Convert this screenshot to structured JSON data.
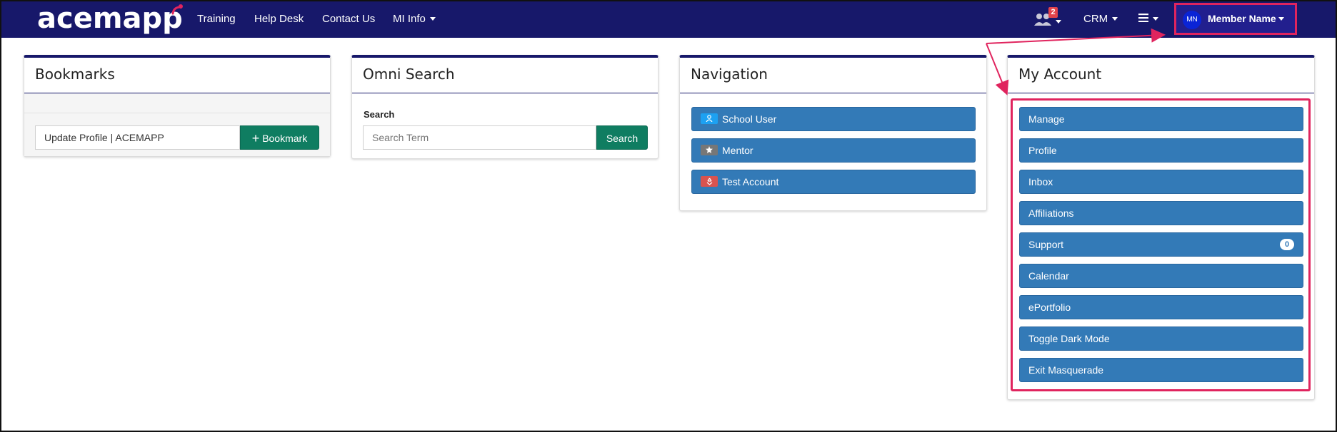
{
  "navbar": {
    "logo_text": "acemapp",
    "links": [
      {
        "label": "Training"
      },
      {
        "label": "Help Desk"
      },
      {
        "label": "Contact Us"
      },
      {
        "label": "MI Info"
      }
    ],
    "notification_count": "2",
    "crm_label": "CRM",
    "menu_icon": "hamburger-icon",
    "member": {
      "initials": "MN",
      "name": "Member Name"
    }
  },
  "bookmarks": {
    "title": "Bookmarks",
    "input_value": "Update Profile | ACEMAPP",
    "button_label": "Bookmark"
  },
  "omni_search": {
    "title": "Omni Search",
    "label": "Search",
    "placeholder": "Search Term",
    "button_label": "Search"
  },
  "navigation": {
    "title": "Navigation",
    "items": [
      {
        "label": "School User",
        "icon": "user-icon",
        "color": "#1da1f2"
      },
      {
        "label": "Mentor",
        "icon": "mentor-icon",
        "color": "#777777"
      },
      {
        "label": "Test Account",
        "icon": "recycle-icon",
        "color": "#d9534f"
      }
    ]
  },
  "my_account": {
    "title": "My Account",
    "items": [
      {
        "label": "Manage"
      },
      {
        "label": "Profile"
      },
      {
        "label": "Inbox"
      },
      {
        "label": "Affiliations"
      },
      {
        "label": "Support",
        "badge": "0"
      },
      {
        "label": "Calendar"
      },
      {
        "label": "ePortfolio"
      },
      {
        "label": "Toggle Dark Mode"
      },
      {
        "label": "Exit Masquerade"
      }
    ]
  },
  "colors": {
    "navbar": "#17186a",
    "accent_highlight": "#e0245e",
    "primary_button": "#337ab7",
    "success_button": "#0f7d61"
  }
}
